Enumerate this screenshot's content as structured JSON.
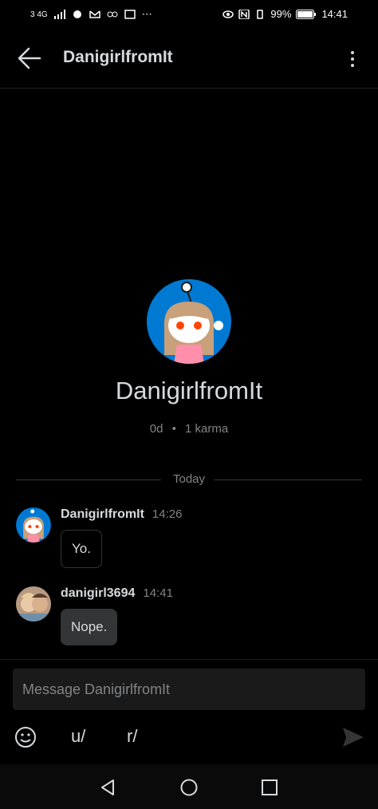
{
  "status_bar": {
    "network": "3 4G",
    "battery": "99%",
    "time": "14:41"
  },
  "header": {
    "title": "DanigirlfromIt"
  },
  "profile": {
    "name": "DanigirlfromIt",
    "age": "0d",
    "separator": "•",
    "karma": "1 karma"
  },
  "divider": {
    "label": "Today"
  },
  "messages": [
    {
      "author": "DanigirlfromIt",
      "time": "14:26",
      "text": "Yo."
    },
    {
      "author": "danigirl3694",
      "time": "14:41",
      "text": "Nope."
    }
  ],
  "composer": {
    "placeholder": "Message DanigirlfromIt",
    "user_prefix": "u/",
    "sub_prefix": "r/"
  },
  "colors": {
    "accent": "#0079d3",
    "bubble_mine": "#343536",
    "background": "#000000"
  }
}
